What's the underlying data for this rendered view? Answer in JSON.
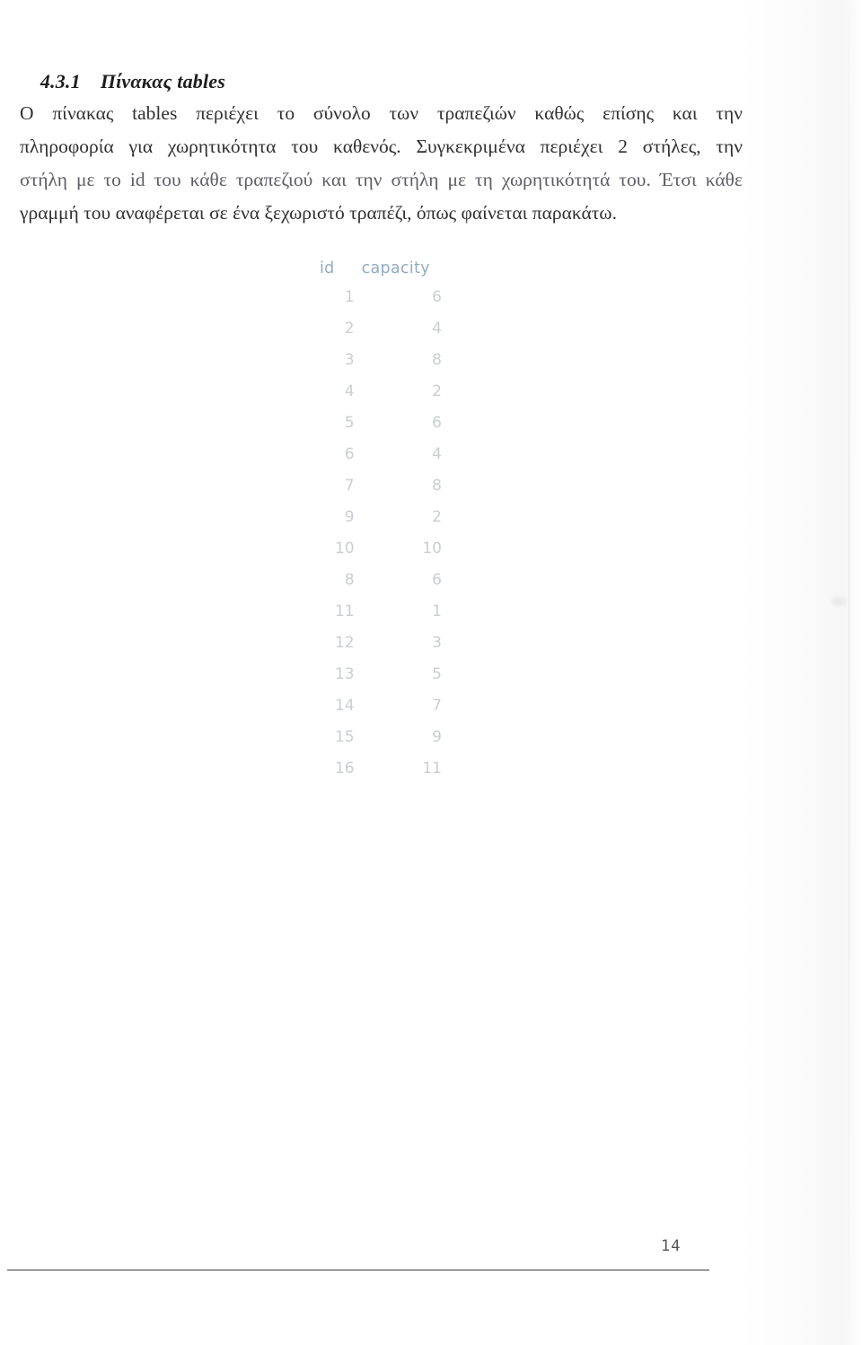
{
  "document": {
    "language": "el",
    "page_number": "14"
  },
  "heading": {
    "number": "4.3.1",
    "title": "Πίνακας tables"
  },
  "paragraph": {
    "lines": [
      "Ο πίνακας tables περιέχει το σύνολο των τραπεζιών καθώς επίσης και την",
      "πληροφορία για χωρητικότητα του καθενός. Συγκεκριμένα περιέχει 2 στήλες, την",
      "στήλη με το id του κάθε τραπεζιού και την στήλη με τη χωρητικότητά του. Έτσι κάθε",
      "γραμμή του αναφέρεται σε ένα ξεχωριστό τραπέζι, όπως φαίνεται παρακάτω."
    ]
  },
  "figure": {
    "caption": "",
    "colors": {
      "header": "#93abc0",
      "cell": "#c9ced2"
    },
    "columns": [
      "id",
      "capacity"
    ],
    "rows": [
      {
        "id": "1",
        "capacity": "6"
      },
      {
        "id": "2",
        "capacity": "4"
      },
      {
        "id": "3",
        "capacity": "8"
      },
      {
        "id": "4",
        "capacity": "2"
      },
      {
        "id": "5",
        "capacity": "6"
      },
      {
        "id": "6",
        "capacity": "4"
      },
      {
        "id": "7",
        "capacity": "8"
      },
      {
        "id": "9",
        "capacity": "2"
      },
      {
        "id": "10",
        "capacity": "10"
      },
      {
        "id": "8",
        "capacity": "6"
      },
      {
        "id": "11",
        "capacity": "1"
      },
      {
        "id": "12",
        "capacity": "3"
      },
      {
        "id": "13",
        "capacity": "5"
      },
      {
        "id": "14",
        "capacity": "7"
      },
      {
        "id": "15",
        "capacity": "9"
      },
      {
        "id": "16",
        "capacity": "11"
      }
    ]
  }
}
